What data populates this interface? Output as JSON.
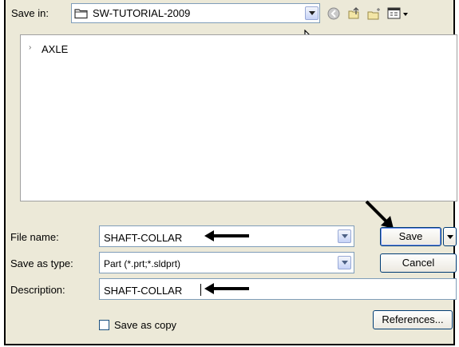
{
  "save_in": {
    "label": "Save in:",
    "value": "SW-TUTORIAL-2009"
  },
  "toolbar_icons": [
    "back-icon",
    "up-folder-icon",
    "new-folder-icon",
    "views-menu-icon"
  ],
  "file_list": {
    "items": [
      {
        "name": "AXLE",
        "icon": "part-file-icon"
      }
    ]
  },
  "file_name": {
    "label": "File name:",
    "value": "SHAFT-COLLAR"
  },
  "save_as_type": {
    "label": "Save as type:",
    "value": "Part (*.prt;*.sldprt)"
  },
  "description": {
    "label": "Description:",
    "value": "SHAFT-COLLAR"
  },
  "save_as_copy": {
    "label": "Save as copy",
    "checked": false
  },
  "buttons": {
    "save": "Save",
    "cancel": "Cancel",
    "references": "References..."
  }
}
